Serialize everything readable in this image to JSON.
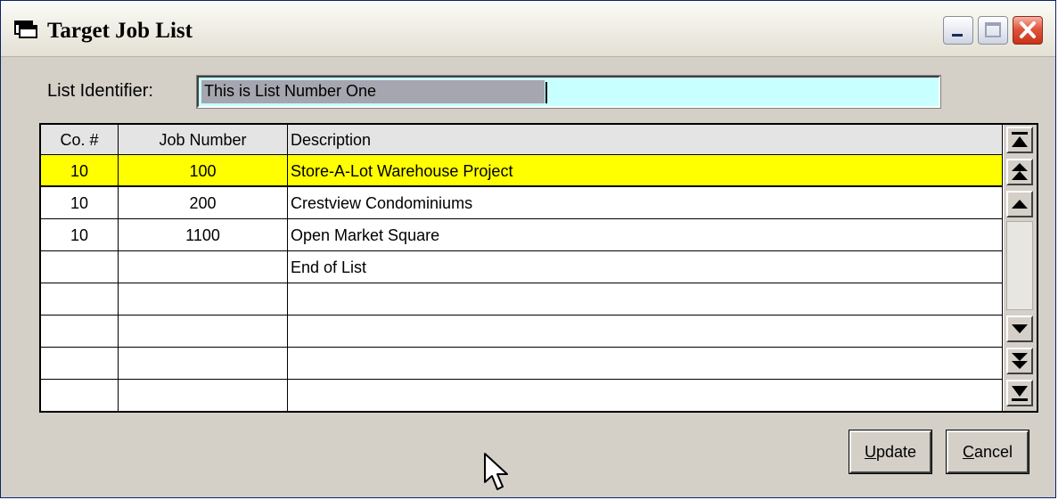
{
  "window": {
    "title": "Target Job List",
    "icons": {
      "app": "window-app-icon",
      "minimize": "minimize-icon",
      "maximize": "maximize-icon",
      "close": "close-icon"
    }
  },
  "list_identifier": {
    "label": "List Identifier:",
    "value": "This is List Number One",
    "field_color": "#c8ffff",
    "selection_color": "#a6a6b0"
  },
  "grid": {
    "headers": {
      "co": "Co. #",
      "job": "Job Number",
      "desc": "Description"
    },
    "selected_row_color": "#ffff00",
    "rows": [
      {
        "co": "10",
        "job": "100",
        "desc": "Store-A-Lot Warehouse Project",
        "selected": true
      },
      {
        "co": "10",
        "job": "200",
        "desc": "Crestview Condominiums"
      },
      {
        "co": "10",
        "job": "1100",
        "desc": "Open Market Square"
      },
      {
        "co": "",
        "job": "",
        "desc": "End of List"
      },
      {
        "co": "",
        "job": "",
        "desc": ""
      },
      {
        "co": "",
        "job": "",
        "desc": ""
      },
      {
        "co": "",
        "job": "",
        "desc": ""
      },
      {
        "co": "",
        "job": "",
        "desc": ""
      }
    ],
    "scrollbar_icons": [
      "scroll-first-icon",
      "scroll-page-up-icon",
      "scroll-up-icon",
      "scroll-down-icon",
      "scroll-page-down-icon",
      "scroll-last-icon"
    ]
  },
  "buttons": {
    "update": {
      "accel": "U",
      "rest": "pdate"
    },
    "cancel": {
      "accel": "C",
      "rest": "ancel"
    }
  },
  "cursor_icon": "mouse-pointer-icon"
}
